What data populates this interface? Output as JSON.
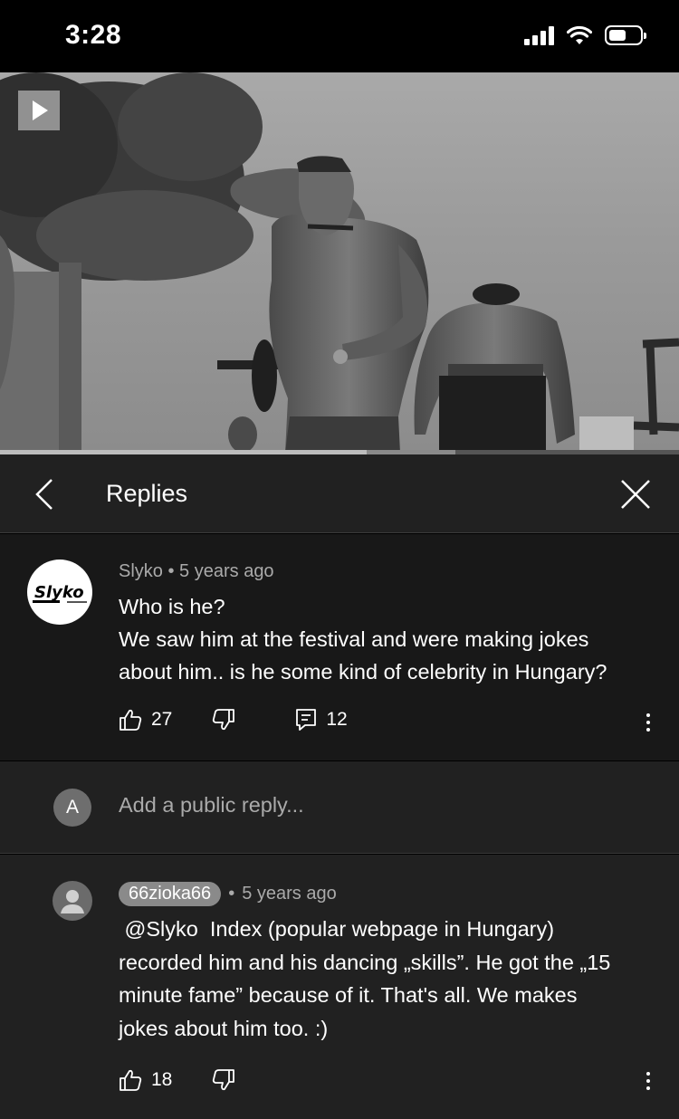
{
  "status_bar": {
    "time": "3:28"
  },
  "video": {
    "progress": 0.54,
    "buffered": 0.67
  },
  "header": {
    "title": "Replies"
  },
  "comment": {
    "author": "Slyko",
    "time": "5 years ago",
    "lines": [
      "Who is he?",
      "We saw him at the festival and were making jokes",
      "about him.. is he some kind of celebrity in Hungary?"
    ],
    "likes": "27",
    "replies": "12",
    "avatar_text": "Slyko"
  },
  "add_reply": {
    "avatar_letter": "A",
    "placeholder": "Add a public reply..."
  },
  "reply": {
    "author": "66zioka66",
    "time": "5 years ago",
    "lines": [
      " @Slyko  Index (popular webpage in Hungary)",
      "recorded him and his dancing „skills”. He got the „15",
      "minute fame” because of it. That's all. We makes",
      "jokes about him too. :)"
    ],
    "likes": "18"
  },
  "separator": "•"
}
